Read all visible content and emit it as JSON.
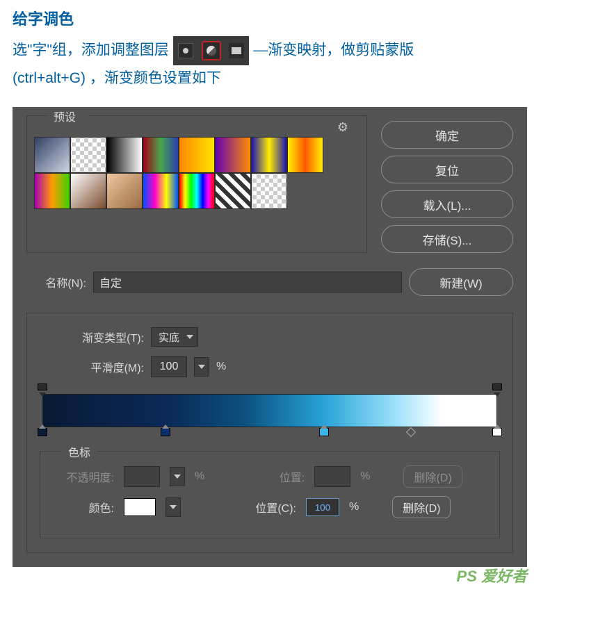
{
  "article": {
    "title": "给字调色",
    "line1a": "选\"字\"组，添加调整图层",
    "line1b": "—渐变映射，做剪贴蒙版",
    "line2": "(ctrl+alt+G) ，渐变颜色设置如下"
  },
  "dialog": {
    "presets_label": "预设",
    "gear_label": "gear",
    "buttons": {
      "ok": "确定",
      "reset": "复位",
      "load": "载入(L)...",
      "save": "存储(S)..."
    },
    "name_label": "名称(N):",
    "name_value": "自定",
    "new_button": "新建(W)",
    "grad_type_label": "渐变类型(T):",
    "grad_type_value": "实底",
    "smoothness_label": "平滑度(M):",
    "smoothness_value": "100",
    "percent": "%",
    "stops_legend": "色标",
    "opacity_label": "不透明度:",
    "position_label": "位置:",
    "delete_label": "删除(D)",
    "color_label": "颜色:",
    "position_c_label": "位置(C):",
    "position_c_value": "100"
  },
  "gradient_stops": {
    "opacity": [
      {
        "pos": 0
      },
      {
        "pos": 100
      }
    ],
    "color": [
      {
        "pos": 0,
        "color": "#081a34"
      },
      {
        "pos": 27,
        "color": "#0c2e69"
      },
      {
        "pos": 62,
        "color": "#3db5e6"
      },
      {
        "pos": 100,
        "color": "#ffffff"
      }
    ],
    "midpoints": [
      {
        "pos": 81
      }
    ]
  },
  "swatches": [
    "linear-gradient(135deg,#303f63,#cfd6e5)",
    "repeating-conic-gradient(#ccc 0 25%,#fff 0 50%) 50%/12px 12px",
    "linear-gradient(90deg,#000,#fff)",
    "linear-gradient(90deg,#a1001a,#4aa84a,#2a3fb0)",
    "linear-gradient(90deg,#ff8800,#ffe400)",
    "linear-gradient(90deg,#6600b4,#ff8d00)",
    "linear-gradient(90deg,#1b12b0,#fff000,#1b12b0)",
    "linear-gradient(90deg,#ffef00,#ff5900,#ffef00)",
    "linear-gradient(90deg,#a800b8,#ff9b00,#38d400)",
    "linear-gradient(135deg,#fff,#7a4c2f)",
    "linear-gradient(135deg,#efc7a0,#9a6c44)",
    "linear-gradient(90deg,#0050ff,#ff00cf,#ffff00,#0050ff)",
    "linear-gradient(90deg,#ff0000,#ffff00,#00ff00,#00ffff,#0000ff,#ff00ff,#ff0000)",
    "repeating-linear-gradient(45deg,#333 0 6px,#fff 6px 12px)",
    "repeating-conic-gradient(#ccc 0 25%,#fff 0 50%) 50%/12px 12px"
  ],
  "watermark": "PS 爱好者"
}
